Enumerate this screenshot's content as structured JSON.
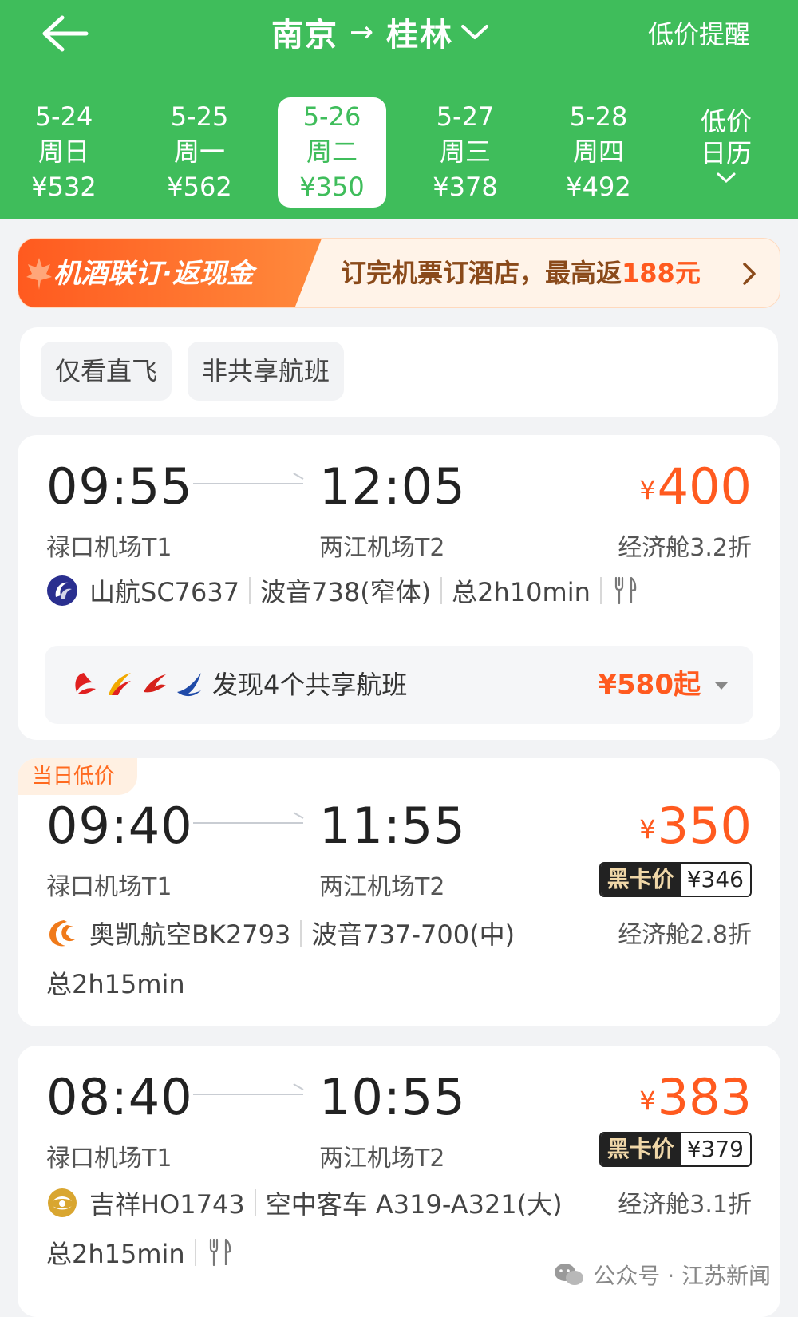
{
  "header": {
    "from_city": "南京",
    "arrow": "→",
    "to_city": "桂林",
    "low_price_alert": "低价提醒",
    "calendar_line1": "低价",
    "calendar_line2": "日历",
    "bg_color": "#3fbd5b"
  },
  "dates": [
    {
      "date": "5-24",
      "weekday": "周日",
      "price": "¥532",
      "active": false
    },
    {
      "date": "5-25",
      "weekday": "周一",
      "price": "¥562",
      "active": false
    },
    {
      "date": "5-26",
      "weekday": "周二",
      "price": "¥350",
      "active": true
    },
    {
      "date": "5-27",
      "weekday": "周三",
      "price": "¥378",
      "active": false
    },
    {
      "date": "5-28",
      "weekday": "周四",
      "price": "¥492",
      "active": false
    }
  ],
  "promo": {
    "tag": "机酒联订·返现金",
    "text_prefix": "订完机票订酒店，最高返",
    "text_highlight": "188元"
  },
  "filters": [
    "仅看直飞",
    "非共享航班"
  ],
  "flights": [
    {
      "dep_time": "09:55",
      "arr_time": "12:05",
      "dep_airport": "禄口机场T1",
      "arr_airport": "两江机场T2",
      "currency": "¥",
      "price": "400",
      "cabin": "经济舱3.2折",
      "airline": "山航SC7637",
      "aircraft": "波音738(窄体)",
      "duration": "总2h10min",
      "meal_icon": "meal-icon",
      "share_text": "发现4个共享航班",
      "share_price": "¥580起"
    },
    {
      "tag": "当日低价",
      "dep_time": "09:40",
      "arr_time": "11:55",
      "dep_airport": "禄口机场T1",
      "arr_airport": "两江机场T2",
      "currency": "¥",
      "price": "350",
      "black_card_label": "黑卡价",
      "black_card_price": "¥346",
      "cabin": "经济舱2.8折",
      "airline": "奥凯航空BK2793",
      "aircraft": "波音737-700(中)",
      "duration": "总2h15min"
    },
    {
      "dep_time": "08:40",
      "arr_time": "10:55",
      "dep_airport": "禄口机场T1",
      "arr_airport": "两江机场T2",
      "currency": "¥",
      "price": "383",
      "black_card_label": "黑卡价",
      "black_card_price": "¥379",
      "cabin": "经济舱3.1折",
      "airline": "吉祥HO1743",
      "aircraft": "空中客车 A319-A321(大)",
      "duration": "总2h15min",
      "meal_icon": "meal-icon"
    }
  ],
  "watermark": {
    "text": "公众号 · 江苏新闻"
  },
  "colors": {
    "accent": "#3fbd5b",
    "price": "#ff5a1f"
  }
}
